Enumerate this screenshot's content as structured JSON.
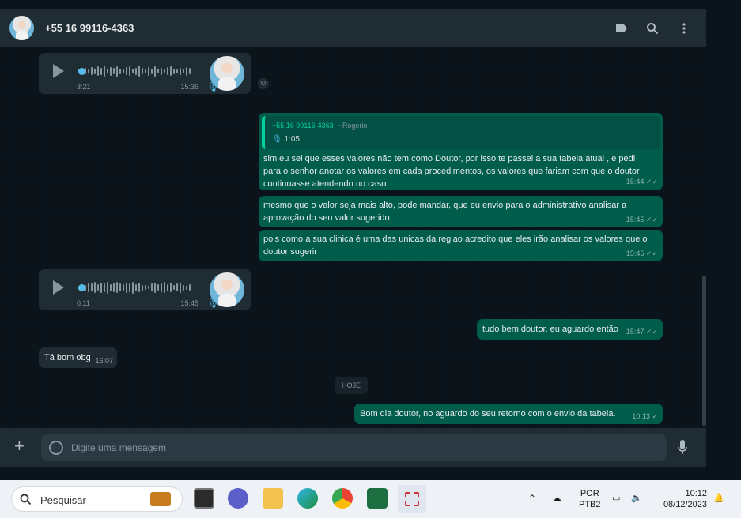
{
  "header": {
    "contact": "+55 16 99116-4363",
    "icons": [
      "label-icon",
      "search-icon",
      "menu-icon"
    ]
  },
  "messages": {
    "voice1": {
      "duration": "3:21",
      "time": "15:36"
    },
    "quoted": {
      "name": "+55 16 99116-4363",
      "sub": "~Rogerio",
      "line": "1:05",
      "text": "sim eu sei que esses valores não tem como Doutor, por isso te passei a sua tabela atual , e pedi para o senhor anotar os valores em cada procedimentos, os valores que fariam com que o doutor continuasse atendendo no caso",
      "time": "15:44"
    },
    "m2": {
      "text": "mesmo que o valor seja mais alto, pode mandar, que eu envio para o administrativo analisar a aprovação do seu valor sugerido",
      "time": "15:45"
    },
    "m3": {
      "text": "pois como a sua clinica é uma das unicas da regiao acredito que eles irão analisar os valores que o doutor sugerir",
      "time": "15:45"
    },
    "voice2": {
      "duration": "0:11",
      "time": "15:45"
    },
    "m4": {
      "text": "tudo bem doutor, eu aguardo então",
      "time": "15:47"
    },
    "in1": {
      "text": "Tá bom obg",
      "time": "16:07"
    },
    "day": "HOJE",
    "m5": {
      "text": "Bom dia doutor, no aguardo do seu retorno com o envio da tabela.",
      "time": "10:13"
    }
  },
  "composer": {
    "placeholder": "Digite uma mensagem"
  },
  "taskbar": {
    "search": "Pesquisar",
    "lang1": "POR",
    "lang2": "PTB2",
    "clock_time": "10:12",
    "clock_date": "08/12/2023"
  },
  "colors": {
    "outgoing": "#005c4b",
    "incoming": "#202c33",
    "accent": "#06cf9c",
    "read_blue": "#53bdeb"
  }
}
